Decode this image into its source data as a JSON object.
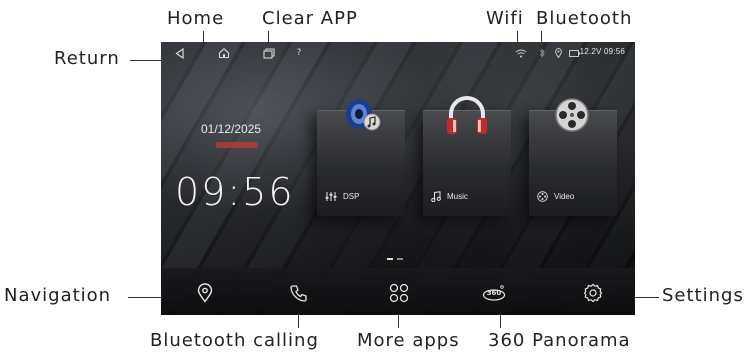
{
  "callouts": {
    "home": "Home",
    "clear_app": "Clear APP",
    "wifi": "Wifi",
    "bluetooth": "Bluetooth",
    "return": "Return",
    "navigation": "Navigation",
    "settings": "Settings",
    "bluetooth_calling": "Bluetooth calling",
    "more_apps": "More apps",
    "panorama_360": "360 Panorama"
  },
  "status_bar": {
    "right_text": "12.2V 09:56"
  },
  "home_screen": {
    "date": "01/12/2025",
    "clock": "09:56"
  },
  "tiles": [
    {
      "label": "DSP",
      "icon": "dsp-speaker-icon"
    },
    {
      "label": "Music",
      "icon": "headphones-icon"
    },
    {
      "label": "Video",
      "icon": "film-reel-icon"
    }
  ],
  "dock": {
    "icons": [
      "navigation-pin-icon",
      "phone-icon",
      "grid-apps-icon",
      "panorama-360-icon",
      "settings-gear-icon"
    ]
  },
  "colors": {
    "accent_red": "#c23a3a",
    "screen_bg": "#222222"
  }
}
